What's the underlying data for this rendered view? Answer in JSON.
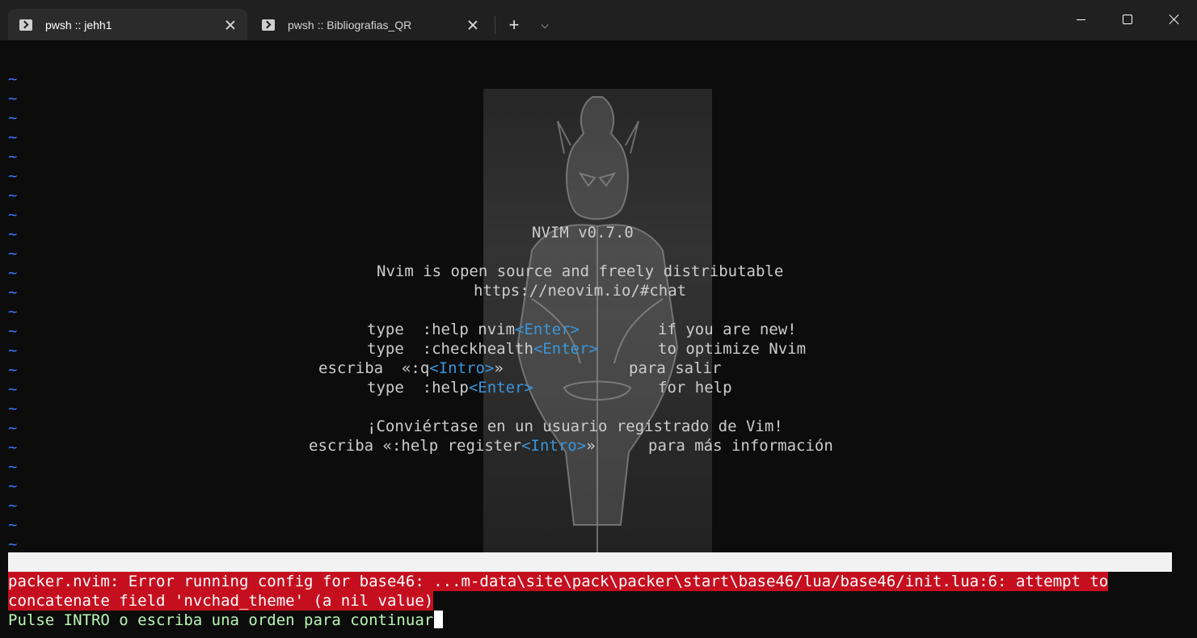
{
  "window": {
    "tabs": [
      {
        "label": "pwsh :: jehh1",
        "icon": "powershell-icon",
        "active": true
      },
      {
        "label": "pwsh :: Bibliografias_QR",
        "icon": "powershell-icon",
        "active": false
      }
    ],
    "new_tab": "+",
    "dropdown": "⌵"
  },
  "editor": {
    "tilde": "~",
    "intro": {
      "version": "NVIM v0.7.0",
      "line1": "Nvim is open source and freely distributable",
      "line2": "https://neovim.io/#chat",
      "help_nvim_cmd": "type  :help nvim",
      "help_nvim_key": "<Enter>",
      "help_nvim_desc": "if you are new!",
      "checkhealth_cmd": "type  :checkhealth",
      "checkhealth_key": "<Enter>",
      "checkhealth_desc": "to optimize Nvim",
      "quit_cmd": "escriba  «:q",
      "quit_key": "<Intro>",
      "quit_close": "»",
      "quit_desc": "para salir",
      "help_cmd": "type  :help",
      "help_key": "<Enter>",
      "help_desc": "for help",
      "register_title": "¡Conviértase en un usuario registrado de Vim!",
      "register_cmd": "escriba «:help register",
      "register_key": "<Intro>",
      "register_close": "»",
      "register_desc": "para más información"
    },
    "error_line1": "packer.nvim: Error running config for base46: ...m-data\\site\\pack\\packer\\start\\base46/lua/base46/init.lua:6: attempt to",
    "error_line2": "concatenate field 'nvchad_theme' (a nil value)",
    "prompt": "Pulse INTRO o escriba una orden para continuar"
  },
  "colors": {
    "tilde": "#3b78ff",
    "key": "#3a96dd",
    "error_bg": "#c50f1f",
    "prompt": "#b9f6b5"
  }
}
